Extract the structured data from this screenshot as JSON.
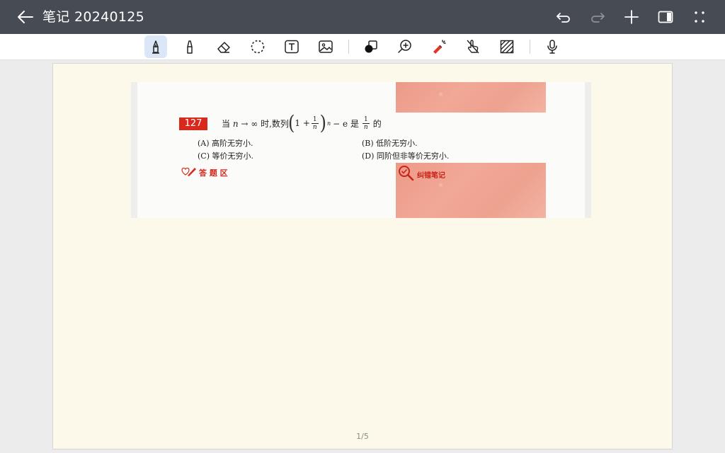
{
  "app": {
    "title": "笔记 20240125"
  },
  "colors": {
    "topbar": "#474b54",
    "toolbar": "#ffffff",
    "page": "#fdf9ea",
    "active_tool": "#dbe6f7",
    "accent_red": "#d9281c"
  },
  "topbar": {
    "icons": [
      "back-arrow-icon",
      "undo-icon",
      "redo-icon",
      "add-icon",
      "sidebar-panel-icon",
      "more-dots-icon"
    ]
  },
  "toolbar": {
    "tools": [
      {
        "name": "pen-icon",
        "active": true
      },
      {
        "name": "highlighter-icon",
        "active": false
      },
      {
        "name": "eraser-icon",
        "active": false
      },
      {
        "name": "lasso-icon",
        "active": false
      },
      {
        "name": "text-box-icon",
        "active": false
      },
      {
        "name": "image-icon",
        "active": false
      },
      {
        "name": "shape-icon",
        "active": false
      },
      {
        "name": "zoom-icon",
        "active": false
      },
      {
        "name": "laser-pointer-icon",
        "active": false
      },
      {
        "name": "hand-touch-icon",
        "active": false
      },
      {
        "name": "background-pattern-icon",
        "active": false
      },
      {
        "name": "microphone-icon",
        "active": false
      }
    ]
  },
  "question": {
    "number": "127",
    "prefix": "当",
    "var_n": "n",
    "arrow": "→ ∞",
    "mid_text": " 时,数列",
    "one": "1 +",
    "frac_num": "1",
    "frac_den": "n",
    "exp": "n",
    "minus_e": "− e 是",
    "rhs_num": "1",
    "rhs_den": "n",
    "suffix": "的",
    "options": {
      "A": "(A) 高阶无穷小.",
      "B": "(B) 低阶无穷小.",
      "C": "(C) 等价无穷小.",
      "D": "(D) 同阶但非等价无穷小."
    },
    "answer_area_label": "答 题 区",
    "error_notes_label": "纠错笔记"
  },
  "page_indicator": "1/5"
}
